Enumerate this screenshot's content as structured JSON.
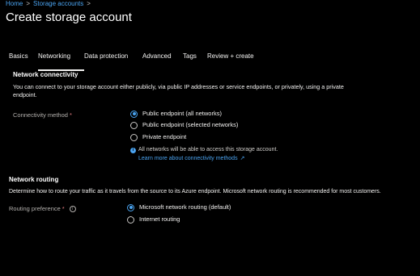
{
  "breadcrumb": {
    "items": [
      "Home",
      "Storage accounts"
    ],
    "separator": ">"
  },
  "page": {
    "title": "Create storage account"
  },
  "tabs": [
    {
      "label": "Basics",
      "active": false
    },
    {
      "label": "Networking",
      "active": true
    },
    {
      "label": "Data protection",
      "active": false
    },
    {
      "label": "Advanced",
      "active": false
    },
    {
      "label": "Tags",
      "active": false
    },
    {
      "label": "Review + create",
      "active": false
    }
  ],
  "network_connectivity": {
    "heading": "Network connectivity",
    "description": "You can connect to your storage account either publicly, via public IP addresses or service endpoints, or privately, using a private endpoint.",
    "field_label": "Connectivity method",
    "required_marker": "*",
    "options": [
      {
        "label": "Public endpoint (all networks)",
        "checked": true
      },
      {
        "label": "Public endpoint (selected networks)",
        "checked": false
      },
      {
        "label": "Private endpoint",
        "checked": false
      }
    ],
    "info_text": "All networks will be able to access this storage account.",
    "learn_more": "Learn more about connectivity methods"
  },
  "network_routing": {
    "heading": "Network routing",
    "description": "Determine how to route your traffic as it travels from the source to its Azure endpoint. Microsoft network routing is recommended for most customers.",
    "field_label": "Routing preference",
    "required_marker": "*",
    "options": [
      {
        "label": "Microsoft network routing (default)",
        "checked": true
      },
      {
        "label": "Internet routing",
        "checked": false
      }
    ]
  },
  "colors": {
    "background": "#000000",
    "accent": "#4aa3f0",
    "text": "#f3f2f1",
    "muted": "#b3b0ad",
    "required": "#e37d80"
  }
}
